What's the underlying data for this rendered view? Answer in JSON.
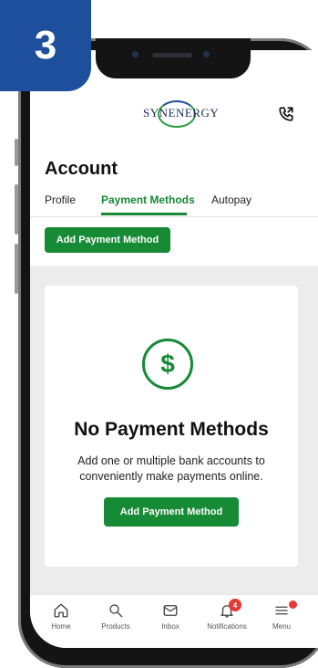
{
  "step": {
    "number": "3"
  },
  "header": {
    "logo_text": "SYNENERGY"
  },
  "page": {
    "title": "Account"
  },
  "tabs": [
    {
      "label": "Profile"
    },
    {
      "label": "Payment Methods",
      "active": true
    },
    {
      "label": "Autopay"
    }
  ],
  "actions": {
    "add_payment_top": "Add Payment Method"
  },
  "empty_state": {
    "icon": "dollar-icon",
    "title": "No Payment Methods",
    "description": "Add one or multiple bank accounts to conveniently make payments online.",
    "button_label": "Add Payment Method"
  },
  "tabbar": {
    "items": [
      {
        "label": "Home",
        "icon": "home-icon"
      },
      {
        "label": "Products",
        "icon": "search-icon"
      },
      {
        "label": "Inbox",
        "icon": "mail-icon"
      },
      {
        "label": "Notifications",
        "icon": "bell-icon",
        "badge": "4"
      },
      {
        "label": "Menu",
        "icon": "menu-icon"
      }
    ]
  },
  "colors": {
    "accent_green": "#168a35",
    "badge_blue": "#1d4f9c",
    "alert_red": "#e53935"
  }
}
